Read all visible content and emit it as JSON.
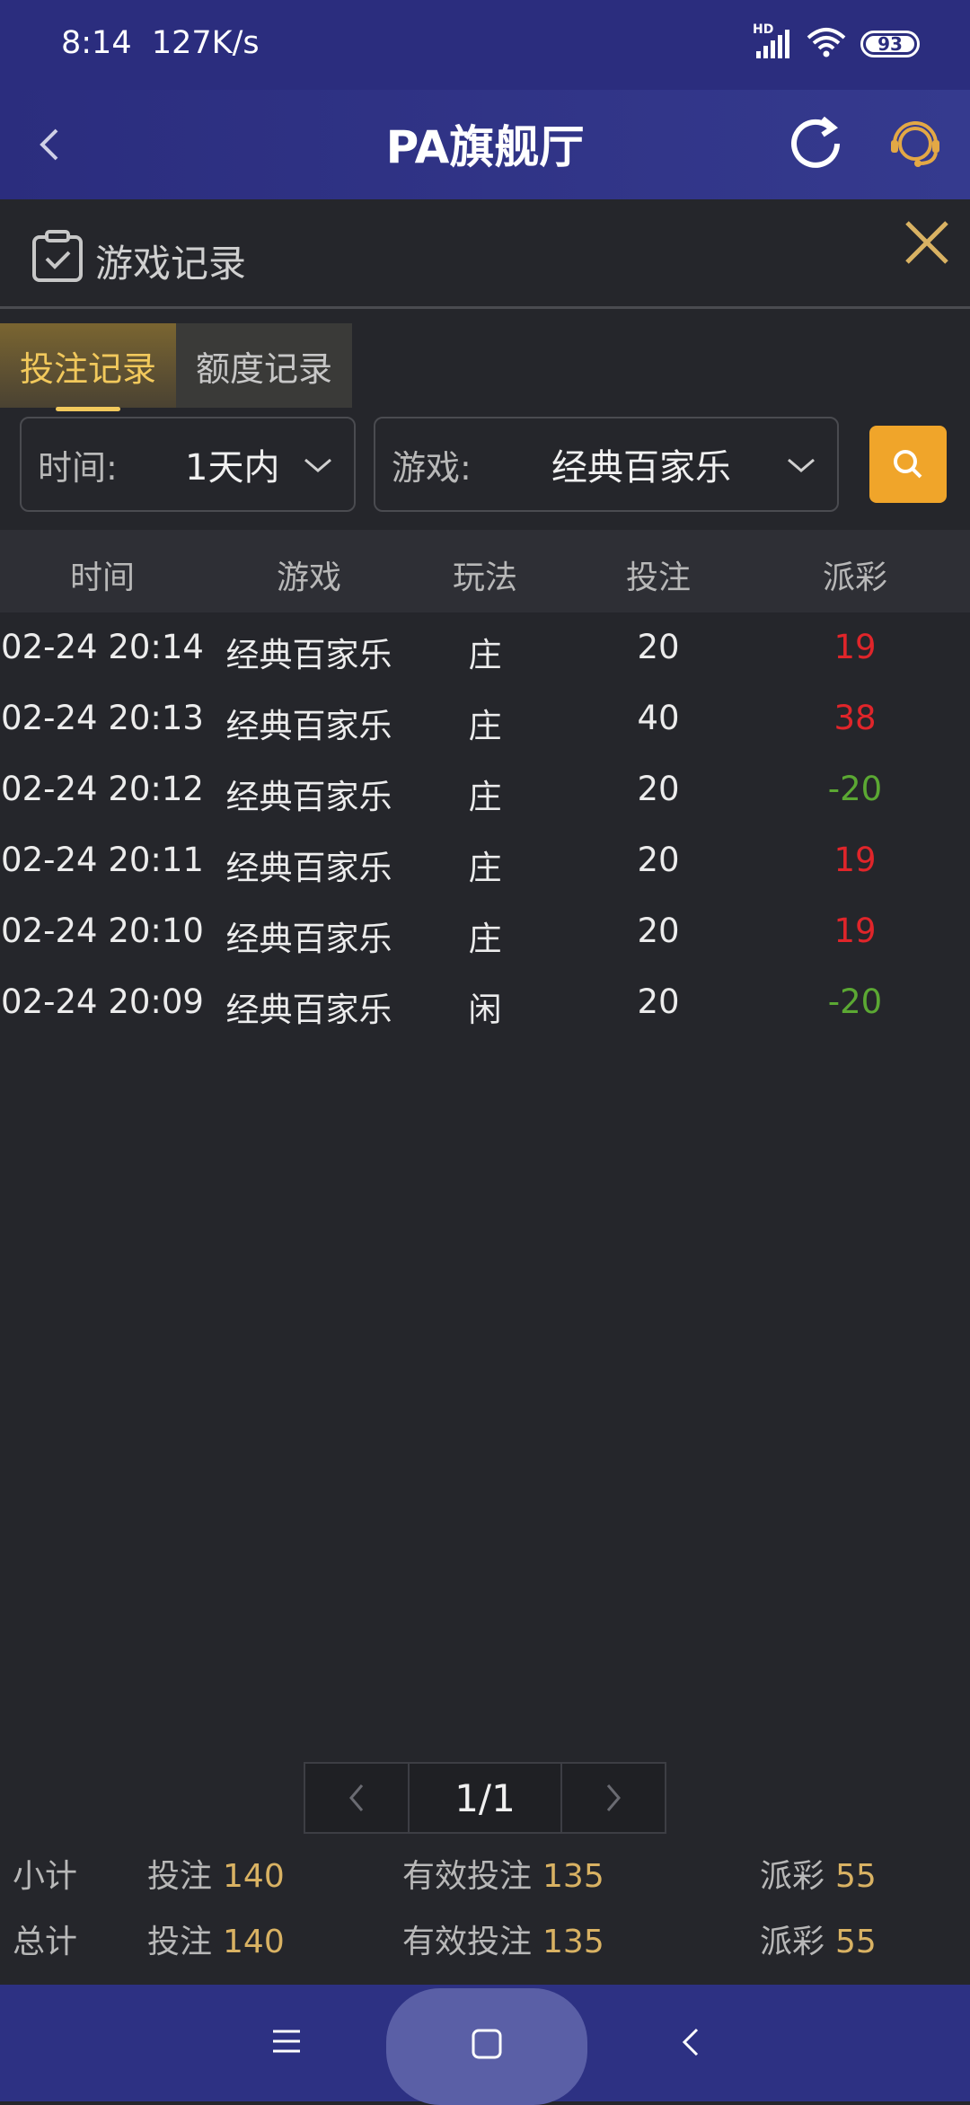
{
  "status_bar": {
    "time": "8:14",
    "speed": "127K/s",
    "battery": "93",
    "signal_label": "HD"
  },
  "header": {
    "title": "PA旗舰厅"
  },
  "panel": {
    "title": "游戏记录"
  },
  "tabs": [
    {
      "label": "投注记录",
      "active": true
    },
    {
      "label": "额度记录",
      "active": false
    }
  ],
  "filters": {
    "time_label": "时间:",
    "time_value": "1天内",
    "game_label": "游戏:",
    "game_value": "经典百家乐"
  },
  "table": {
    "columns": [
      "时间",
      "游戏",
      "玩法",
      "投注",
      "派彩"
    ],
    "rows": [
      {
        "time": "02-24 20:14",
        "game": "经典百家乐",
        "play": "庄",
        "bet": "20",
        "payout": "19",
        "result": "win"
      },
      {
        "time": "02-24 20:13",
        "game": "经典百家乐",
        "play": "庄",
        "bet": "40",
        "payout": "38",
        "result": "win"
      },
      {
        "time": "02-24 20:12",
        "game": "经典百家乐",
        "play": "庄",
        "bet": "20",
        "payout": "-20",
        "result": "lose"
      },
      {
        "time": "02-24 20:11",
        "game": "经典百家乐",
        "play": "庄",
        "bet": "20",
        "payout": "19",
        "result": "win"
      },
      {
        "time": "02-24 20:10",
        "game": "经典百家乐",
        "play": "庄",
        "bet": "20",
        "payout": "19",
        "result": "win"
      },
      {
        "time": "02-24 20:09",
        "game": "经典百家乐",
        "play": "闲",
        "bet": "20",
        "payout": "-20",
        "result": "lose"
      }
    ]
  },
  "pager": {
    "page": "1/1"
  },
  "summary": {
    "subtotal": {
      "label": "小计",
      "bet_label": "投注",
      "bet": "140",
      "valid_label": "有效投注",
      "valid": "135",
      "payout_label": "派彩",
      "payout": "55"
    },
    "total": {
      "label": "总计",
      "bet_label": "投注",
      "bet": "140",
      "valid_label": "有效投注",
      "valid": "135",
      "payout_label": "派彩",
      "payout": "55"
    }
  },
  "colors": {
    "accent": "#f0a52a",
    "win": "#e0252a",
    "lose": "#5ba833",
    "header_bg": "#2b2d7e"
  }
}
